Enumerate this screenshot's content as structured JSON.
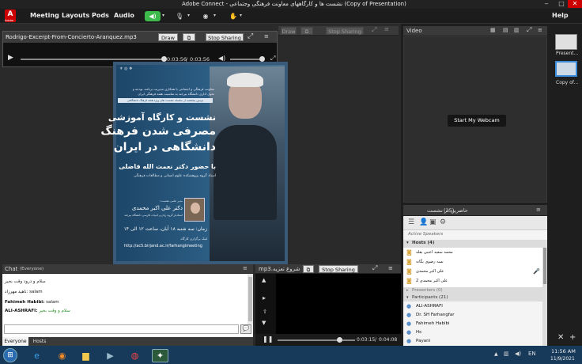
{
  "window": {
    "title": "Adobe Connect - نشست ها و کارگاههای معاونت فرهنگی وجتماعی (Copy of Presentation)",
    "help": "Help"
  },
  "menubar": {
    "logo": "Adobe",
    "items": [
      "Meeting",
      "Layouts",
      "Pods",
      "Audio"
    ]
  },
  "presenter_toolbar": {
    "file_name": "Rodrigo-Excerpt-From-Concierto-Aranquez.mp3",
    "draw_label": "Draw",
    "stop_sharing_label": "Stop Sharing",
    "time_current": "0:03:56",
    "time_total": "0:03:56",
    "behind_draw": "Draw",
    "behind_stop": "Stop Sharing"
  },
  "poster": {
    "line1": "معاونت فرهنگی و اجتماعی با همکاری مدیریت برنامه، بودجه و",
    "line2": "تحول اداری دانشگاه بیرجند به مناسبت هفته فرهنگی ایران",
    "line3": "دومین پنجشنبه از سلسله نشست های ویژه هفته فرهنگ دانشگاهی",
    "headline1": "نشست و کارگاه آموزشی",
    "headline2": "مصرفی شدن فرهنگ",
    "headline3": "دانشگاهی در ایران",
    "presenter_line": "با حضور دکتر نعمت الله فاضلی",
    "presenter_role": "استاد گروه پژوهشکده علوم انسانی و مطالعات فرهنگی",
    "host_label": "مدیر علمی نشست:",
    "host_name": "دکتر علی اکبر محمدی",
    "host_role": "استادیار گروه زبان و ادبیات فارسی دانشگاه بیرجند",
    "date_line": "زمان: سه شنبه ۱۸ آبان، ساعت ۱۲ الی ۱۴",
    "link_label": "لینک برگزاری کارگاه",
    "url": "http://ac5.birjand.ac.ir/farhangimeeting"
  },
  "video": {
    "title": "Video",
    "webcam_button": "Start My Webcam"
  },
  "thumbs": [
    "Present...",
    "Copy of..."
  ],
  "attendees": {
    "title": "حاضرین در نشست",
    "count": "(25)",
    "active_speakers": "Active Speakers",
    "hosts_label": "Hosts (4)",
    "hosts": [
      "محمد سعید اعتبی بقله",
      "بسه رضوی یگانه",
      "علی اکبر محمدی",
      "علی اکبر محمدی 2"
    ],
    "presenters_label": "Presenters (0)",
    "participants_label": "Participants (21)",
    "participants": [
      "ALI-ASHRAFI",
      "Dr. SH Farhangfar",
      "Fahimeh Habibi",
      "Hs",
      "Payani"
    ]
  },
  "chat": {
    "title": "Chat",
    "scope": "(Everyone)",
    "messages": [
      {
        "name": "",
        "text": "سلام و درود وقت بخیر"
      },
      {
        "name": "ناهید مهرزاد:",
        "text": "salam"
      },
      {
        "name": "Fahimeh Habibi:",
        "text": "salam"
      },
      {
        "name": "ALI-ASHRAFI:",
        "text": "سلام و وقت بخیر"
      }
    ],
    "tabs": [
      "Everyone",
      "Hosts"
    ]
  },
  "player2": {
    "file_name": "شروع تعزیه.mp3",
    "stop_sharing_label": "Stop Sharing",
    "time_current": "0:03:15",
    "time_total": "0:04:08"
  },
  "taskbar": {
    "lang": "EN",
    "time": "11:56 AM",
    "date": "11/9/2021"
  },
  "colors": {
    "poster_bg": "#2f5f86",
    "hosts_highlight": "#ffffff",
    "accent_green": "#3db84a"
  }
}
